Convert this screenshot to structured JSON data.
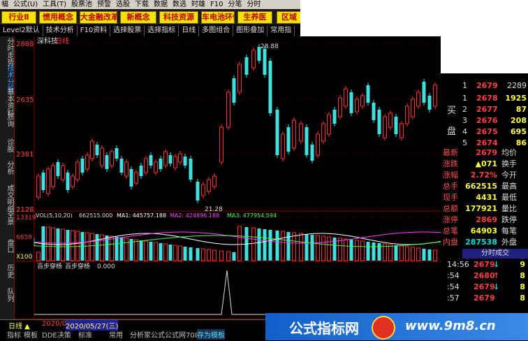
{
  "menu": [
    "幅",
    "公式(U)",
    "工具(T)",
    "股票池",
    "预警",
    "选股",
    "下载",
    "数据",
    "数选",
    "时雄",
    "F10",
    "分笔",
    "分时"
  ],
  "categories": [
    "行业Ⅱ",
    "惯用概念",
    "大金融改革",
    "新概念",
    "科技资源",
    "车电池环保",
    "生养医",
    "区域"
  ],
  "toolbar": [
    "Level2默认",
    "技术分析",
    "F10资料",
    "选择股票",
    "选择指标",
    "日线",
    "多图组合",
    "图形叠加",
    "常用指"
  ],
  "side_tabs": [
    "分时走势",
    "技术分析",
    "基本资料",
    "质询",
    "诊股",
    "分析",
    "成交明细",
    "全景",
    "盘口",
    "历史",
    "队列"
  ],
  "chart": {
    "title": "深科技",
    "period": "日线",
    "price_axis": [
      "2888",
      "2635",
      "2381",
      "2128"
    ],
    "high_label": "28.88",
    "low_label": "21.28",
    "vol_label": "VOL(5,10,20)",
    "vol_value": "662515.000",
    "ma1": "MA1: 445757.188",
    "ma2": "MA2: 424896.188",
    "ma3": "MA3: 477954.594",
    "vol_axis": [
      "13319",
      "6659",
      "X100"
    ],
    "ind_label": "百步穿杨",
    "ind_name": "百步穿杨",
    "ind_value": "0.000",
    "colors": {
      "up": "#ff3030",
      "down": "#40e0e0",
      "ma1": "#ffffff",
      "ma2": "#ff40ff",
      "ma3": "#40ff40"
    }
  },
  "orderbook": {
    "sell": [
      {
        "lvl": "1",
        "price": "2679",
        "vol": "2289"
      }
    ],
    "buy_label_1": "买",
    "buy_label_2": "盘",
    "buy": [
      {
        "lvl": "1",
        "price": "2678",
        "vol": "1925"
      },
      {
        "lvl": "2",
        "price": "2677",
        "vol": "87"
      },
      {
        "lvl": "3",
        "price": "2676",
        "vol": "208"
      },
      {
        "lvl": "4",
        "price": "2675",
        "vol": "695"
      },
      {
        "lvl": "5",
        "price": "2674",
        "vol": "86"
      }
    ]
  },
  "stats": [
    {
      "l": "最新",
      "v": "2679",
      "r": "均价"
    },
    {
      "l": "涨跌",
      "v": "▲071",
      "r": "换手"
    },
    {
      "l": "涨幅",
      "v": "2.72%",
      "r": "今开"
    },
    {
      "l": "总手",
      "v": "662515",
      "r": "最高"
    },
    {
      "l": "现手",
      "v": "4431",
      "r": "最低"
    },
    {
      "l": "总额",
      "v": "177921",
      "r": "量比"
    },
    {
      "l": "涨停",
      "v": "2869",
      "r": "跌停"
    },
    {
      "l": "总笔",
      "v": "64903",
      "r": "每笔"
    },
    {
      "l": "内盘",
      "v": "287538",
      "r": "外盘"
    }
  ],
  "ticks_title": "分时成交",
  "ticks": [
    {
      "t": "14:56",
      "p": "2679",
      "d": "↓",
      "v": "9"
    },
    {
      "t": ":54",
      "p": "2680",
      "d": "↑",
      "v": "8"
    },
    {
      "t": ":54",
      "p": "2679",
      "d": "↓",
      "v": "8"
    },
    {
      "t": ":57",
      "p": "2679",
      "d": "",
      "v": "8"
    }
  ],
  "bottom": {
    "period": "日线",
    "date_a": "2020/0",
    "date_b": "2020/05/27(三)",
    "tabs": [
      "指标",
      "模板",
      "DDE决策",
      "标准",
      "常用",
      "分析家公式",
      "公式网708",
      "存为模板"
    ],
    "left_tab": "指标",
    "left_tab2": "模板"
  },
  "banner": {
    "text": "公式指标网",
    "url": "www.9m8.cn"
  }
}
